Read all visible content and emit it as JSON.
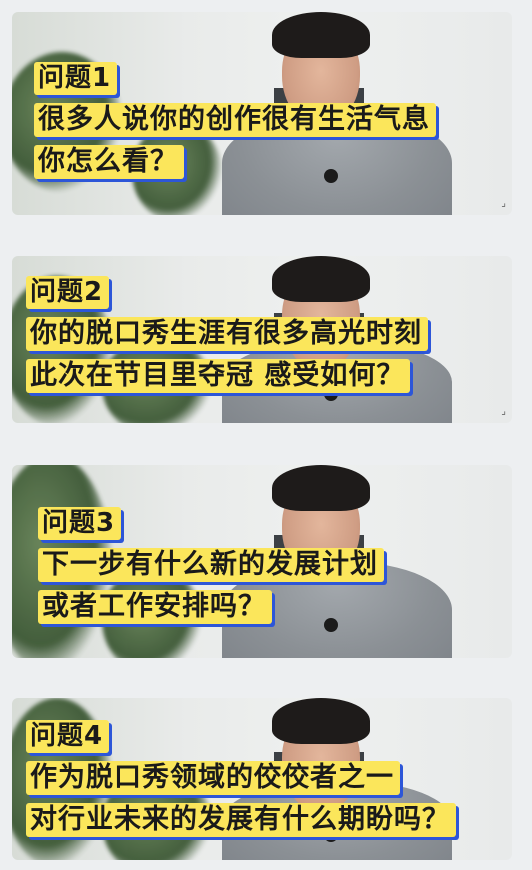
{
  "cards": [
    {
      "label": "问题1",
      "line1": "很多人说你的创作很有生活气息",
      "line2": "你怎么看？"
    },
    {
      "label": "问题2",
      "line1": "你的脱口秀生涯有很多高光时刻",
      "line2": "此次在节目里夺冠 感受如何？"
    },
    {
      "label": "问题3",
      "line1": "下一步有什么新的发展计划",
      "line2": "或者工作安排吗？"
    },
    {
      "label": "问题4",
      "line1": "作为脱口秀领域的佼佼者之一",
      "line2": "对行业未来的发展有什么期盼吗？"
    }
  ],
  "theme": {
    "caption_bg": "#fbe65b",
    "caption_shadow": "#2d56d8",
    "page_bg": "#edeff1"
  },
  "icons": {
    "corner": "resize-handle-icon"
  }
}
